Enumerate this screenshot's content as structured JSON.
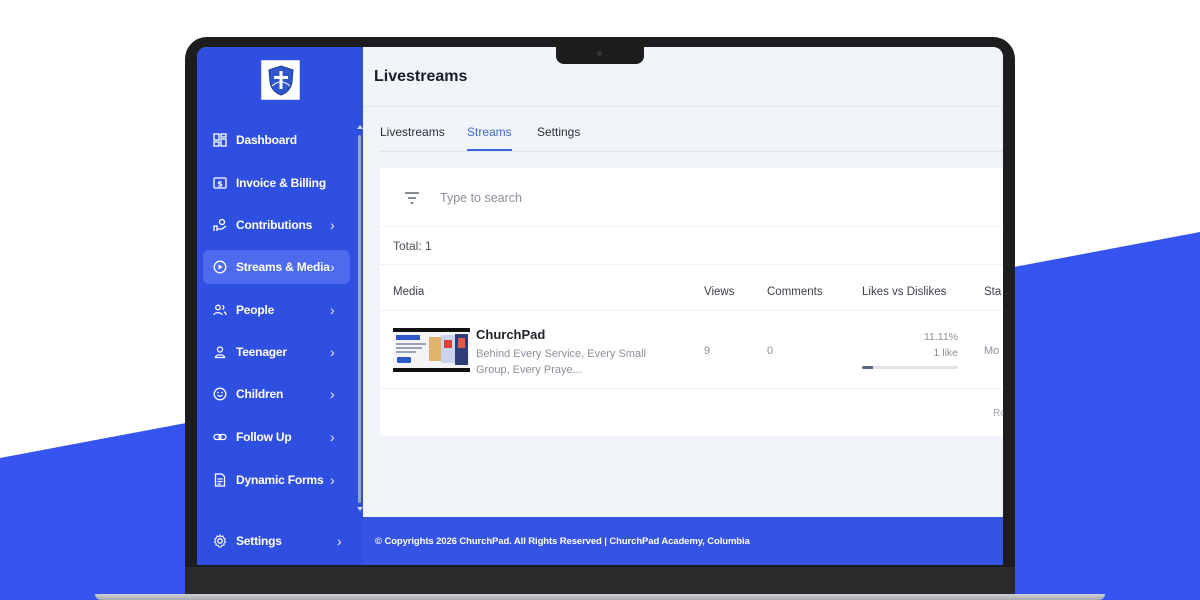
{
  "page": {
    "title": "Livestreams"
  },
  "sidebar": {
    "items": [
      {
        "label": "Dashboard",
        "icon": "dashboard-icon",
        "chevron": ""
      },
      {
        "label": "Invoice & Billing",
        "icon": "invoice-icon",
        "chevron": ""
      },
      {
        "label": "Contributions",
        "icon": "contributions-icon",
        "chevron": "›"
      },
      {
        "label": "Streams & Media",
        "icon": "play-circle-icon",
        "chevron": "›",
        "active": true
      },
      {
        "label": "People",
        "icon": "people-icon",
        "chevron": "›"
      },
      {
        "label": "Teenager",
        "icon": "person-icon",
        "chevron": "›"
      },
      {
        "label": "Children",
        "icon": "smile-icon",
        "chevron": "›"
      },
      {
        "label": "Follow Up",
        "icon": "link-icon",
        "chevron": "›"
      },
      {
        "label": "Dynamic Forms",
        "icon": "form-icon",
        "chevron": "›"
      }
    ],
    "settings": {
      "label": "Settings",
      "icon": "gear-icon",
      "chevron": "›"
    }
  },
  "tabs": [
    {
      "label": "Livestreams"
    },
    {
      "label": "Streams",
      "active": true
    },
    {
      "label": "Settings"
    }
  ],
  "search": {
    "placeholder": "Type to search"
  },
  "total_label": "Total: 1",
  "table": {
    "headers": [
      "Media",
      "Views",
      "Comments",
      "Likes vs Dislikes",
      "Sta"
    ],
    "rows": [
      {
        "title": "ChurchPad",
        "description": "Behind Every Service, Every Small Group, Every Praye...",
        "views": "9",
        "comments": "0",
        "likes_percent": "11.11%",
        "likes_count": "1 like",
        "likes_ratio": 0.11,
        "status": "Mo"
      }
    ],
    "footer_fragment": "Ro"
  },
  "footer": {
    "text": "© Copyrights 2026 ChurchPad. All Rights Reserved | ChurchPad Academy, Columbia"
  },
  "colors": {
    "sidebar": "#2f4fe0",
    "accent": "#3d68d6",
    "background_wave": "#3554f0"
  }
}
